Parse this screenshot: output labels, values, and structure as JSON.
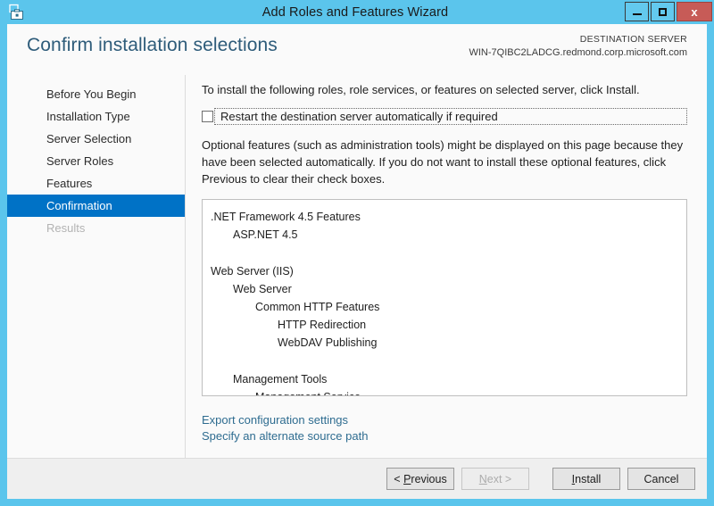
{
  "window": {
    "title": "Add Roles and Features Wizard",
    "icon": "wizard-briefcase-icon",
    "frame_color": "#5BC5EC",
    "minimize_label": "",
    "maximize_label": "",
    "close_label": "x"
  },
  "header": {
    "page_title": "Confirm installation selections",
    "destination_label": "DESTINATION SERVER",
    "destination_server": "WIN-7QIBC2LADCG.redmond.corp.microsoft.com",
    "title_color": "#2E5C7A"
  },
  "sidebar": {
    "selected_color": "#0072C6",
    "items": [
      {
        "label": "Before You Begin",
        "state": "normal"
      },
      {
        "label": "Installation Type",
        "state": "normal"
      },
      {
        "label": "Server Selection",
        "state": "normal"
      },
      {
        "label": "Server Roles",
        "state": "normal"
      },
      {
        "label": "Features",
        "state": "normal"
      },
      {
        "label": "Confirmation",
        "state": "selected"
      },
      {
        "label": "Results",
        "state": "disabled"
      }
    ]
  },
  "content": {
    "intro": "To install the following roles, role services, or features on selected server, click Install.",
    "restart_checkbox": {
      "label": "Restart the destination server automatically if required",
      "checked": false,
      "focused": true
    },
    "optional_note": "Optional features (such as administration tools) might be displayed on this page because they have been selected automatically. If you do not want to install these optional features, click Previous to clear their check boxes.",
    "selections": [
      {
        "label": ".NET Framework 4.5 Features",
        "level": 0,
        "gap_before": false
      },
      {
        "label": "ASP.NET 4.5",
        "level": 1,
        "gap_before": false
      },
      {
        "label": "Web Server (IIS)",
        "level": 0,
        "gap_before": true
      },
      {
        "label": "Web Server",
        "level": 1,
        "gap_before": false
      },
      {
        "label": "Common HTTP Features",
        "level": 2,
        "gap_before": false
      },
      {
        "label": "HTTP Redirection",
        "level": 3,
        "gap_before": false
      },
      {
        "label": "WebDAV Publishing",
        "level": 3,
        "gap_before": false
      },
      {
        "label": "Management Tools",
        "level": 1,
        "gap_before": true
      },
      {
        "label": "Management Service",
        "level": 2,
        "gap_before": false
      }
    ],
    "links": [
      {
        "label": "Export configuration settings",
        "name": "export-configuration-settings-link"
      },
      {
        "label": "Specify an alternate source path",
        "name": "specify-alternate-source-path-link"
      }
    ],
    "link_color": "#2E6C90"
  },
  "footer": {
    "buttons": [
      {
        "label": "< Previous",
        "accel": "P",
        "state": "enabled",
        "name": "previous-button"
      },
      {
        "label": "Next >",
        "accel": "N",
        "state": "disabled",
        "name": "next-button"
      },
      {
        "label": "Install",
        "accel": "I",
        "state": "enabled",
        "name": "install-button"
      },
      {
        "label": "Cancel",
        "accel": "",
        "state": "enabled",
        "name": "cancel-button"
      }
    ]
  }
}
